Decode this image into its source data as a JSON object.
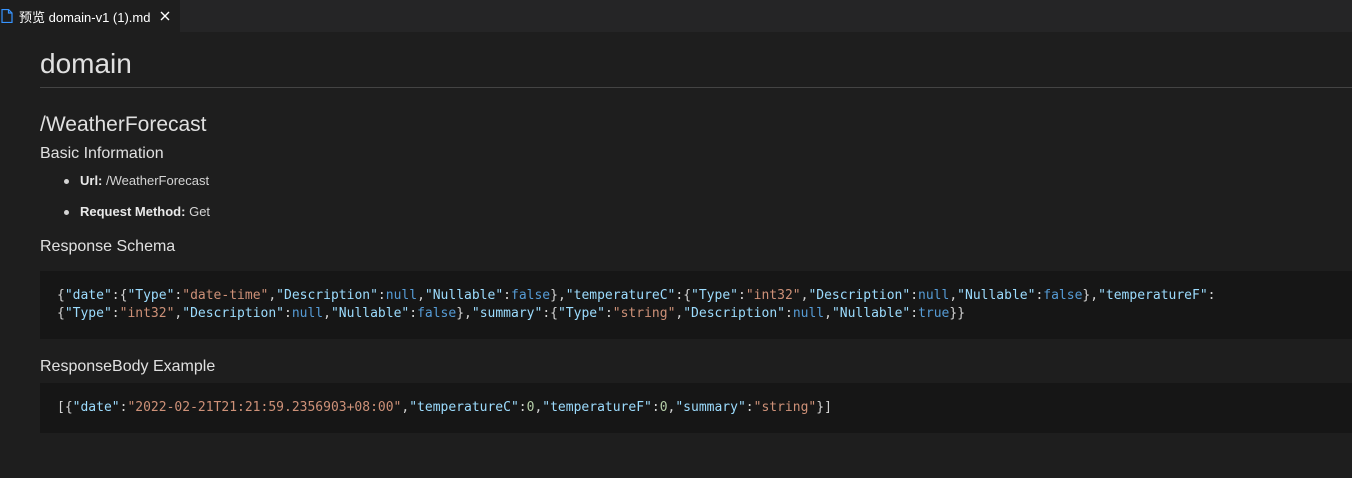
{
  "tab": {
    "icon": "preview-file-icon",
    "label": "预览 domain-v1 (1).md",
    "close_icon": "close-icon"
  },
  "document": {
    "title": "domain",
    "endpoint_heading": "/WeatherForecast",
    "basic_info_heading": "Basic Information",
    "url_label": "Url:",
    "url_value": "/WeatherForecast",
    "method_label": "Request Method:",
    "method_value": "Get",
    "response_schema_heading": "Response Schema",
    "response_schema_lines": [
      [
        {
          "t": "{",
          "c": "p"
        },
        {
          "t": "\"date\"",
          "c": "k"
        },
        {
          "t": ":{",
          "c": "p"
        },
        {
          "t": "\"Type\"",
          "c": "k"
        },
        {
          "t": ":",
          "c": "p"
        },
        {
          "t": "\"date-time\"",
          "c": "s"
        },
        {
          "t": ",",
          "c": "p"
        },
        {
          "t": "\"Description\"",
          "c": "k"
        },
        {
          "t": ":",
          "c": "p"
        },
        {
          "t": "null",
          "c": "kw"
        },
        {
          "t": ",",
          "c": "p"
        },
        {
          "t": "\"Nullable\"",
          "c": "k"
        },
        {
          "t": ":",
          "c": "p"
        },
        {
          "t": "false",
          "c": "kw"
        },
        {
          "t": "},",
          "c": "p"
        },
        {
          "t": "\"temperatureC\"",
          "c": "k"
        },
        {
          "t": ":{",
          "c": "p"
        },
        {
          "t": "\"Type\"",
          "c": "k"
        },
        {
          "t": ":",
          "c": "p"
        },
        {
          "t": "\"int32\"",
          "c": "s"
        },
        {
          "t": ",",
          "c": "p"
        },
        {
          "t": "\"Description\"",
          "c": "k"
        },
        {
          "t": ":",
          "c": "p"
        },
        {
          "t": "null",
          "c": "kw"
        },
        {
          "t": ",",
          "c": "p"
        },
        {
          "t": "\"Nullable\"",
          "c": "k"
        },
        {
          "t": ":",
          "c": "p"
        },
        {
          "t": "false",
          "c": "kw"
        },
        {
          "t": "},",
          "c": "p"
        },
        {
          "t": "\"temperatureF\"",
          "c": "k"
        },
        {
          "t": ":",
          "c": "p"
        }
      ],
      [
        {
          "t": "{",
          "c": "p"
        },
        {
          "t": "\"Type\"",
          "c": "k"
        },
        {
          "t": ":",
          "c": "p"
        },
        {
          "t": "\"int32\"",
          "c": "s"
        },
        {
          "t": ",",
          "c": "p"
        },
        {
          "t": "\"Description\"",
          "c": "k"
        },
        {
          "t": ":",
          "c": "p"
        },
        {
          "t": "null",
          "c": "kw"
        },
        {
          "t": ",",
          "c": "p"
        },
        {
          "t": "\"Nullable\"",
          "c": "k"
        },
        {
          "t": ":",
          "c": "p"
        },
        {
          "t": "false",
          "c": "kw"
        },
        {
          "t": "},",
          "c": "p"
        },
        {
          "t": "\"summary\"",
          "c": "k"
        },
        {
          "t": ":{",
          "c": "p"
        },
        {
          "t": "\"Type\"",
          "c": "k"
        },
        {
          "t": ":",
          "c": "p"
        },
        {
          "t": "\"string\"",
          "c": "s"
        },
        {
          "t": ",",
          "c": "p"
        },
        {
          "t": "\"Description\"",
          "c": "k"
        },
        {
          "t": ":",
          "c": "p"
        },
        {
          "t": "null",
          "c": "kw"
        },
        {
          "t": ",",
          "c": "p"
        },
        {
          "t": "\"Nullable\"",
          "c": "k"
        },
        {
          "t": ":",
          "c": "p"
        },
        {
          "t": "true",
          "c": "kw"
        },
        {
          "t": "}}",
          "c": "p"
        }
      ]
    ],
    "response_example_heading": "ResponseBody Example",
    "response_example_lines": [
      [
        {
          "t": "[{",
          "c": "p"
        },
        {
          "t": "\"date\"",
          "c": "k"
        },
        {
          "t": ":",
          "c": "p"
        },
        {
          "t": "\"2022-02-21T21:21:59.2356903+08:00\"",
          "c": "s"
        },
        {
          "t": ",",
          "c": "p"
        },
        {
          "t": "\"temperatureC\"",
          "c": "k"
        },
        {
          "t": ":",
          "c": "p"
        },
        {
          "t": "0",
          "c": "n"
        },
        {
          "t": ",",
          "c": "p"
        },
        {
          "t": "\"temperatureF\"",
          "c": "k"
        },
        {
          "t": ":",
          "c": "p"
        },
        {
          "t": "0",
          "c": "n"
        },
        {
          "t": ",",
          "c": "p"
        },
        {
          "t": "\"summary\"",
          "c": "k"
        },
        {
          "t": ":",
          "c": "p"
        },
        {
          "t": "\"string\"",
          "c": "s"
        },
        {
          "t": "}]",
          "c": "p"
        }
      ]
    ]
  },
  "colors": {
    "background": "#1e1e1e",
    "tabbar": "#252526",
    "code_background": "#161616",
    "json_key": "#9cdcfe",
    "json_string": "#ce9178",
    "json_number": "#b5cea8",
    "json_keyword": "#569cd6",
    "preview_icon": "#3794ff"
  }
}
